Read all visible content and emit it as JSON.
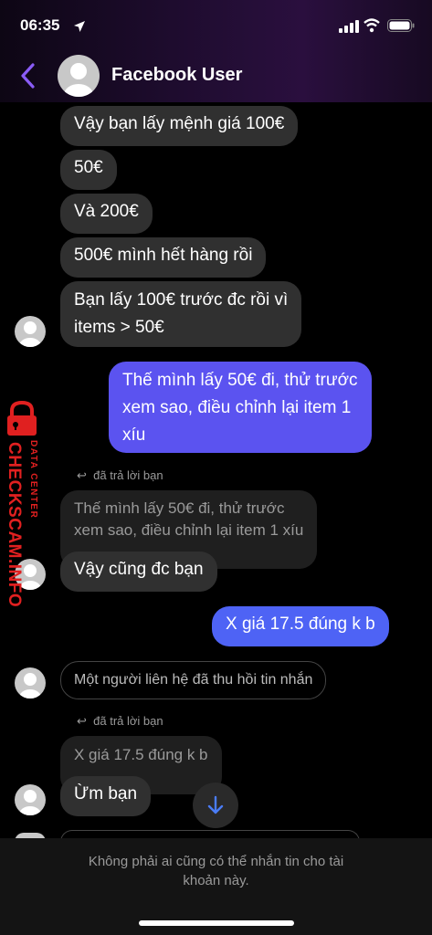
{
  "status": {
    "time": "06:35"
  },
  "header": {
    "title": "Facebook User"
  },
  "messages": {
    "m1": "Vậy bạn lấy mệnh giá 100€",
    "m2": "50€",
    "m3": "Và 200€",
    "m4": "500€ mình hết hàng rồi",
    "m5_line1": "Bạn lấy 100€ trước đc rồi vì",
    "m5_line2": "items > 50€",
    "m6_line1": "Thế mình lấy 50€ đi, thử trước",
    "m6_line2": "xem sao, điều chỉnh lại item 1",
    "m6_line3": "xíu",
    "reply_label_1": "đã trả lời bạn",
    "quote1_line1": "Thế mình lấy 50€ đi, thử trước",
    "quote1_line2": "xem sao, điều chỉnh lại item 1 xíu",
    "m7": "Vậy cũng đc bạn",
    "m8": "X giá 17.5 đúng k b",
    "recalled": "Một người liên hệ đã thu hồi tin nhắn",
    "reply_label_2": "đã trả lời bạn",
    "quote2": "X giá 17.5 đúng k b",
    "m9": "Ừm bạn"
  },
  "footer": {
    "line1": "Không phải ai cũng có thể nhắn tin cho tài",
    "line2": "khoản này."
  },
  "watermark": {
    "top": "DATA CENTER",
    "brand": "CHECKSCAM.INFO"
  },
  "colors": {
    "outgoing": "#5b53f0",
    "incoming": "#303030",
    "accent": "#8a5cf6"
  }
}
